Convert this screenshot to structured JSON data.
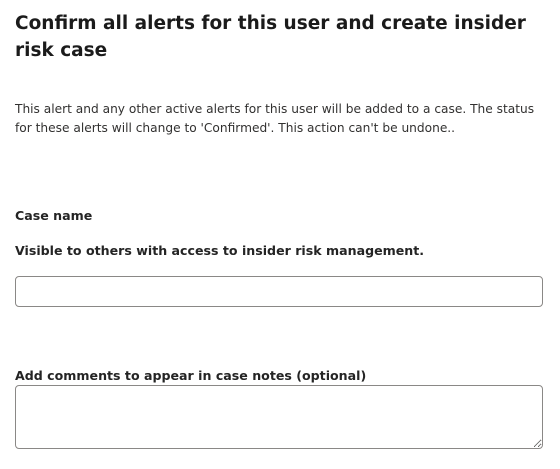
{
  "dialog": {
    "title": "Confirm all alerts for this user and create insider risk case",
    "description": "This alert and any other active alerts for this user will be added to a case. The status for these alerts will change to 'Confirmed'. This action can't be undone..",
    "case_name": {
      "label": "Case name",
      "help_text": "Visible to others with access to insider risk management.",
      "value": "",
      "placeholder": ""
    },
    "comments": {
      "label": "Add comments to appear in case notes (optional)",
      "value": "",
      "placeholder": ""
    }
  }
}
